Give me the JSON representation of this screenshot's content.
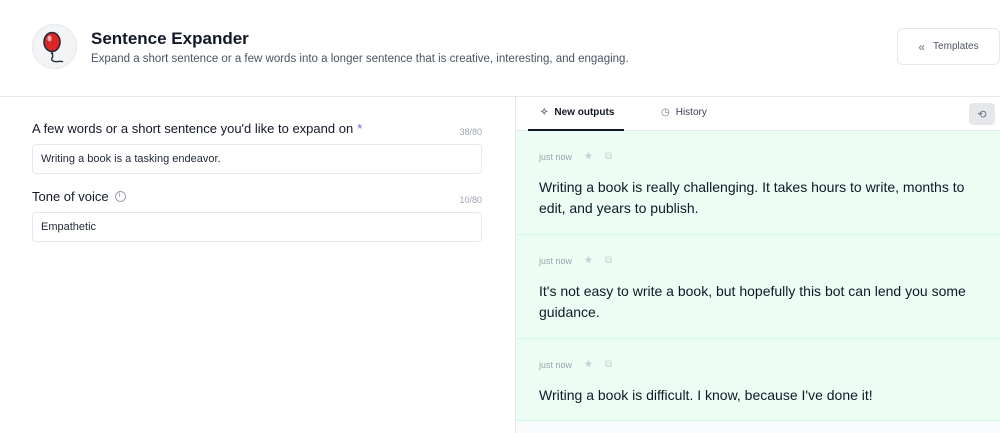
{
  "header": {
    "title": "Sentence Expander",
    "description": "Expand a short sentence or a few words into a longer sentence that is creative, interesting, and engaging.",
    "templates_label": "Templates"
  },
  "form": {
    "field1": {
      "label": "A few words or a short sentence you'd like to expand on",
      "required_mark": "*",
      "counter": "38/80",
      "value": "Writing a book is a tasking endeavor."
    },
    "field2": {
      "label": "Tone of voice",
      "counter": "10/80",
      "value": "Empathetic"
    }
  },
  "panel": {
    "tabs": [
      {
        "label": "New outputs",
        "icon": "sparkle-icon"
      },
      {
        "label": "History",
        "icon": "clock-icon"
      }
    ],
    "outputs": [
      {
        "time": "just now",
        "text": "Writing a book is really challenging. It takes hours to write, months to edit, and years to publish."
      },
      {
        "time": "just now",
        "text": "It's not easy to write a book, but hopefully this bot can lend you some guidance."
      },
      {
        "time": "just now",
        "text": "Writing a book is difficult. I know, because I've done it!"
      }
    ]
  },
  "colors": {
    "output_bg": "#ecfdf3",
    "required": "#6366f1",
    "logo_red": "#dc2626"
  }
}
